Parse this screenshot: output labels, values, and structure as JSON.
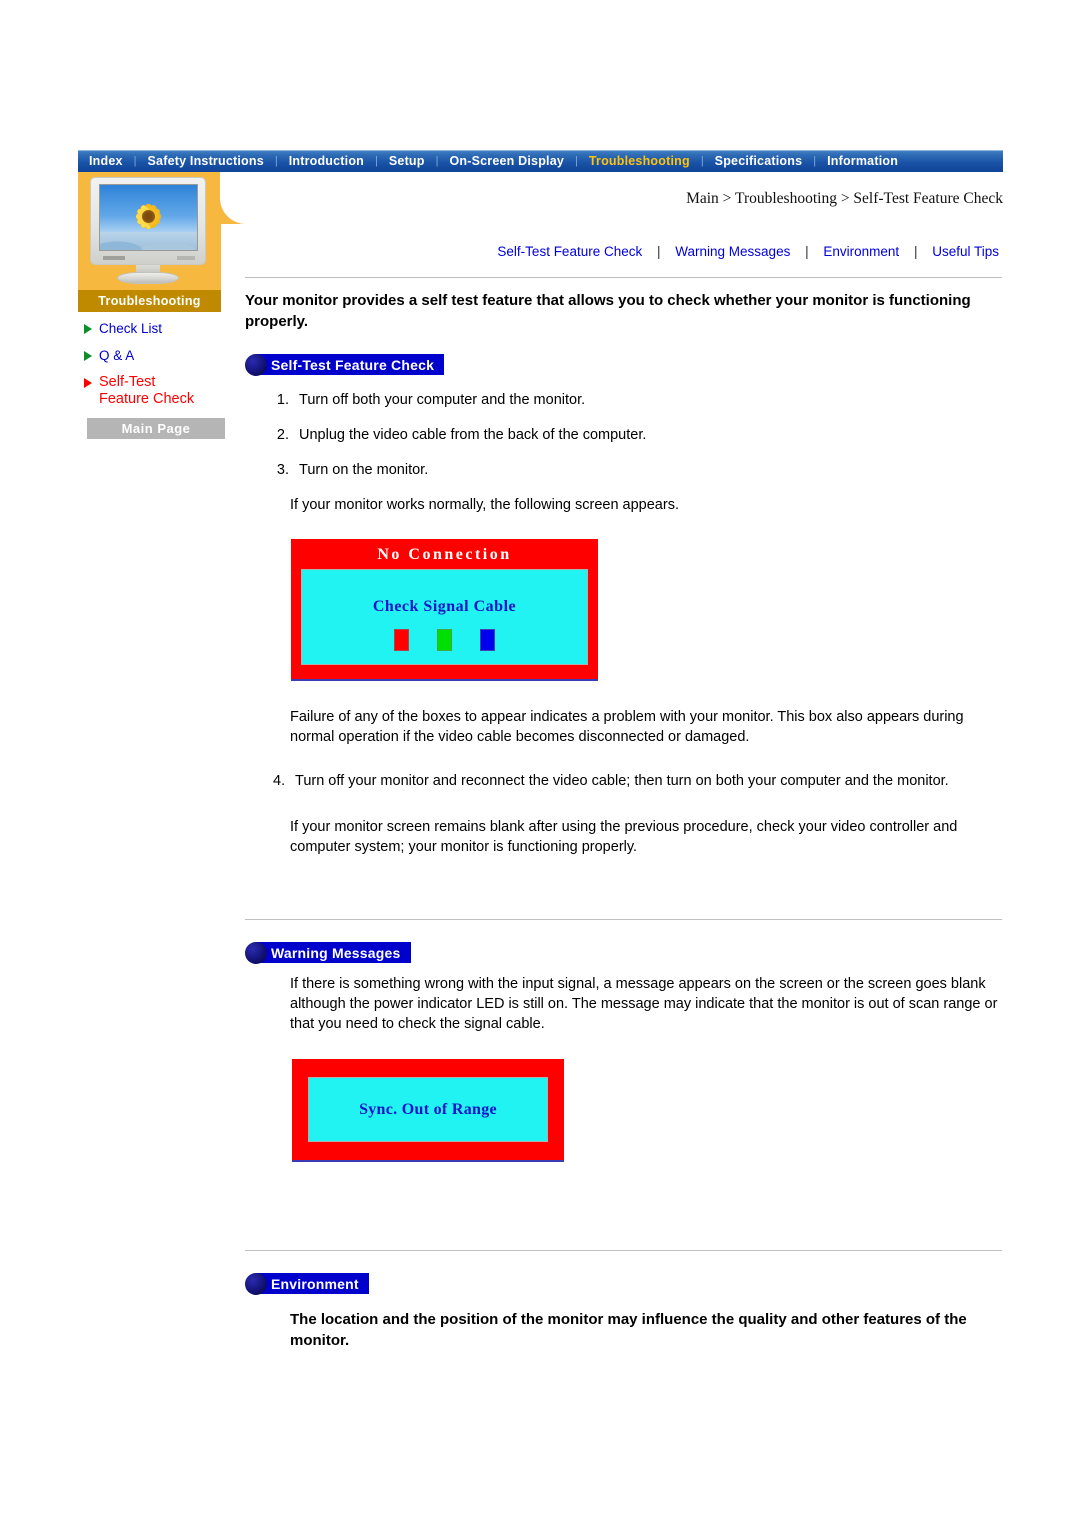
{
  "topnav": {
    "items": [
      {
        "label": "Index",
        "active": false
      },
      {
        "label": "Safety Instructions",
        "active": false
      },
      {
        "label": "Introduction",
        "active": false
      },
      {
        "label": "Setup",
        "active": false
      },
      {
        "label": "On-Screen Display",
        "active": false
      },
      {
        "label": "Troubleshooting",
        "active": true
      },
      {
        "label": "Specifications",
        "active": false
      },
      {
        "label": "Information",
        "active": false
      }
    ],
    "separator": "|",
    "active_color": "#ffc20e",
    "bg_color": "#1a53a8"
  },
  "sidebar": {
    "title": "Troubleshooting",
    "panel_color": "#f7b83f",
    "title_bar_color": "#c08a00",
    "links": [
      {
        "label": "Check List",
        "active": false
      },
      {
        "label": "Q & A",
        "active": false
      },
      {
        "label": "Self-Test\nFeature Check",
        "active": true
      }
    ],
    "link_line1": "Self-Test",
    "link_line2": "Feature Check",
    "main_page_label": "Main Page",
    "link_color": "#0000cc",
    "active_link_color": "#ff0000"
  },
  "breadcrumb": "Main > Troubleshooting > Self-Test Feature Check",
  "subnav": {
    "items": [
      "Self-Test Feature Check",
      "Warning Messages",
      "Environment",
      "Useful Tips"
    ],
    "separator": "|",
    "link_color": "#0000dd"
  },
  "intro": "Your monitor provides a self test feature that allows you to check whether your monitor is functioning properly.",
  "sections": {
    "self_test": {
      "badge": "Self-Test Feature Check",
      "steps": [
        "Turn off both your computer and the monitor.",
        "Unplug the video cable from the back of the computer.",
        "Turn on the monitor."
      ],
      "after_steps": "If your monitor works normally, the following screen appears.",
      "osd": {
        "title": "No Connection",
        "message": "Check Signal Cable",
        "border_color": "#ff0000",
        "screen_color": "#21f2f2",
        "title_color": "#ffffff",
        "message_color": "#1414c8",
        "squares": [
          {
            "name": "red-square",
            "color": "#ff0000"
          },
          {
            "name": "green-square",
            "color": "#00e000"
          },
          {
            "name": "blue-square",
            "color": "#0000ee"
          }
        ]
      },
      "para_failure": "Failure of any of the boxes to appear indicates a problem with your monitor. This box also appears during normal operation if the video cable becomes disconnected or damaged.",
      "step4": "Turn off your monitor and reconnect the video cable; then turn on both your computer and the monitor.",
      "para_blank": "If your monitor screen remains blank after using the previous procedure, check your video controller and computer system; your monitor is functioning properly."
    },
    "warning_messages": {
      "badge": "Warning Messages",
      "para": "If there is something wrong with the input signal, a message appears on the screen or the screen goes blank although the power indicator LED is still on. The message may indicate that the monitor is out of scan range or that you need to check the signal cable.",
      "osd": {
        "message": "Sync. Out of Range",
        "border_color": "#ff0000",
        "screen_color": "#21f2f2",
        "message_color": "#1414c8"
      }
    },
    "environment": {
      "badge": "Environment",
      "para": "The location and the position of the monitor may influence the quality and other features of the monitor."
    }
  }
}
